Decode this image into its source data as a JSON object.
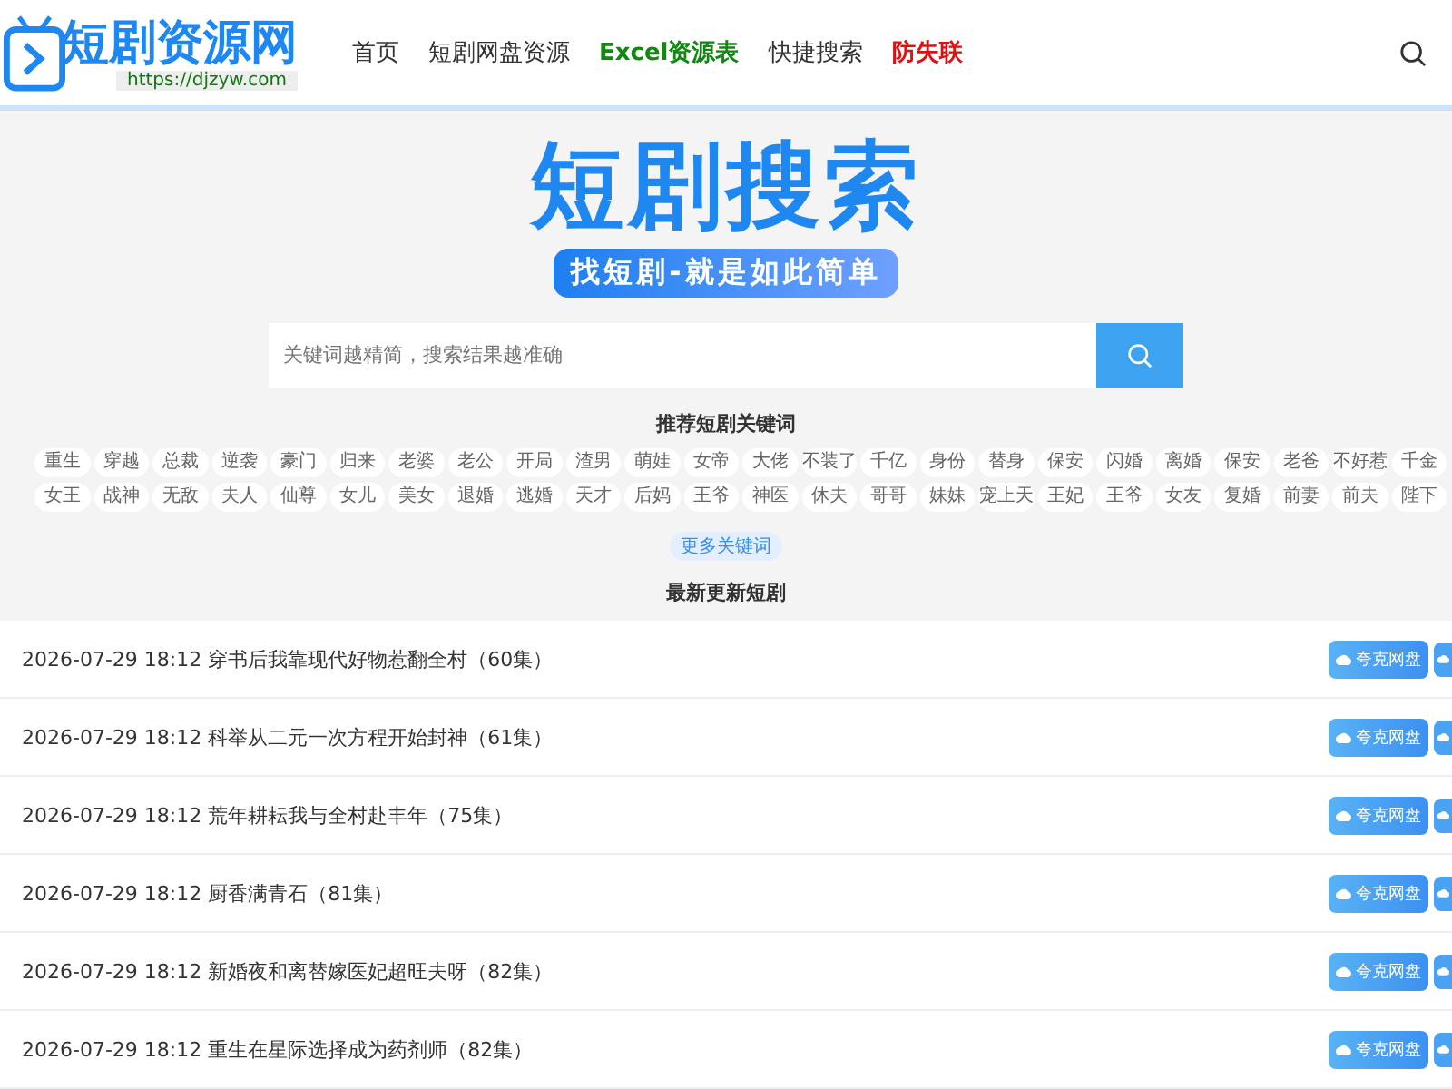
{
  "logo": {
    "name": "短剧资源网",
    "url": "https://djzyw.com"
  },
  "nav": [
    {
      "label": "首页",
      "kind": "plain",
      "color": "#333333"
    },
    {
      "label": "短剧网盘资源",
      "kind": "plain",
      "color": "#333333"
    },
    {
      "label": "Excel资源表",
      "kind": "highlight",
      "color": "#118811"
    },
    {
      "label": "快捷搜索",
      "kind": "plain",
      "color": "#333333"
    },
    {
      "label": "防失联",
      "kind": "highlight",
      "color": "#dd1111"
    }
  ],
  "hero": {
    "title": "短剧搜索",
    "slogan": "找短剧-就是如此简单"
  },
  "search": {
    "placeholder": "关键词越精简，搜索结果越准确"
  },
  "keywords": {
    "heading": "推荐短剧关键词",
    "rows": [
      [
        "重生",
        "穿越",
        "总裁",
        "逆袭",
        "豪门",
        "归来",
        "老婆",
        "老公",
        "开局",
        "渣男",
        "萌娃",
        "女帝",
        "大佬",
        "不装了",
        "千亿",
        "身份",
        "替身",
        "保安",
        "闪婚",
        "离婚",
        "保安",
        "老爸",
        "不好惹",
        "千金"
      ],
      [
        "女王",
        "战神",
        "无敌",
        "夫人",
        "仙尊",
        "女儿",
        "美女",
        "退婚",
        "逃婚",
        "天才",
        "后妈",
        "王爷",
        "神医",
        "休夫",
        "哥哥",
        "妹妹",
        "宠上天",
        "王妃",
        "王爷",
        "女友",
        "复婚",
        "前妻",
        "前夫",
        "陛下"
      ]
    ],
    "more": "更多关键词"
  },
  "latest": {
    "heading": "最新更新短剧",
    "rows": [
      {
        "date": "2026-07-29 18:12",
        "title": "穿书后我靠现代好物惹翻全村（60集）",
        "button": "夸克网盘"
      },
      {
        "date": "2026-07-29 18:12",
        "title": "科举从二元一次方程开始封神（61集）",
        "button": "夸克网盘"
      },
      {
        "date": "2026-07-29 18:12",
        "title": "荒年耕耘我与全村赴丰年（75集）",
        "button": "夸克网盘"
      },
      {
        "date": "2026-07-29 18:12",
        "title": "厨香满青石（81集）",
        "button": "夸克网盘"
      },
      {
        "date": "2026-07-29 18:12",
        "title": "新婚夜和离替嫁医妃超旺夫呀（82集）",
        "button": "夸克网盘"
      },
      {
        "date": "2026-07-29 18:12",
        "title": "重生在星际选择成为药剂师（82集）",
        "button": "夸克网盘"
      }
    ]
  }
}
